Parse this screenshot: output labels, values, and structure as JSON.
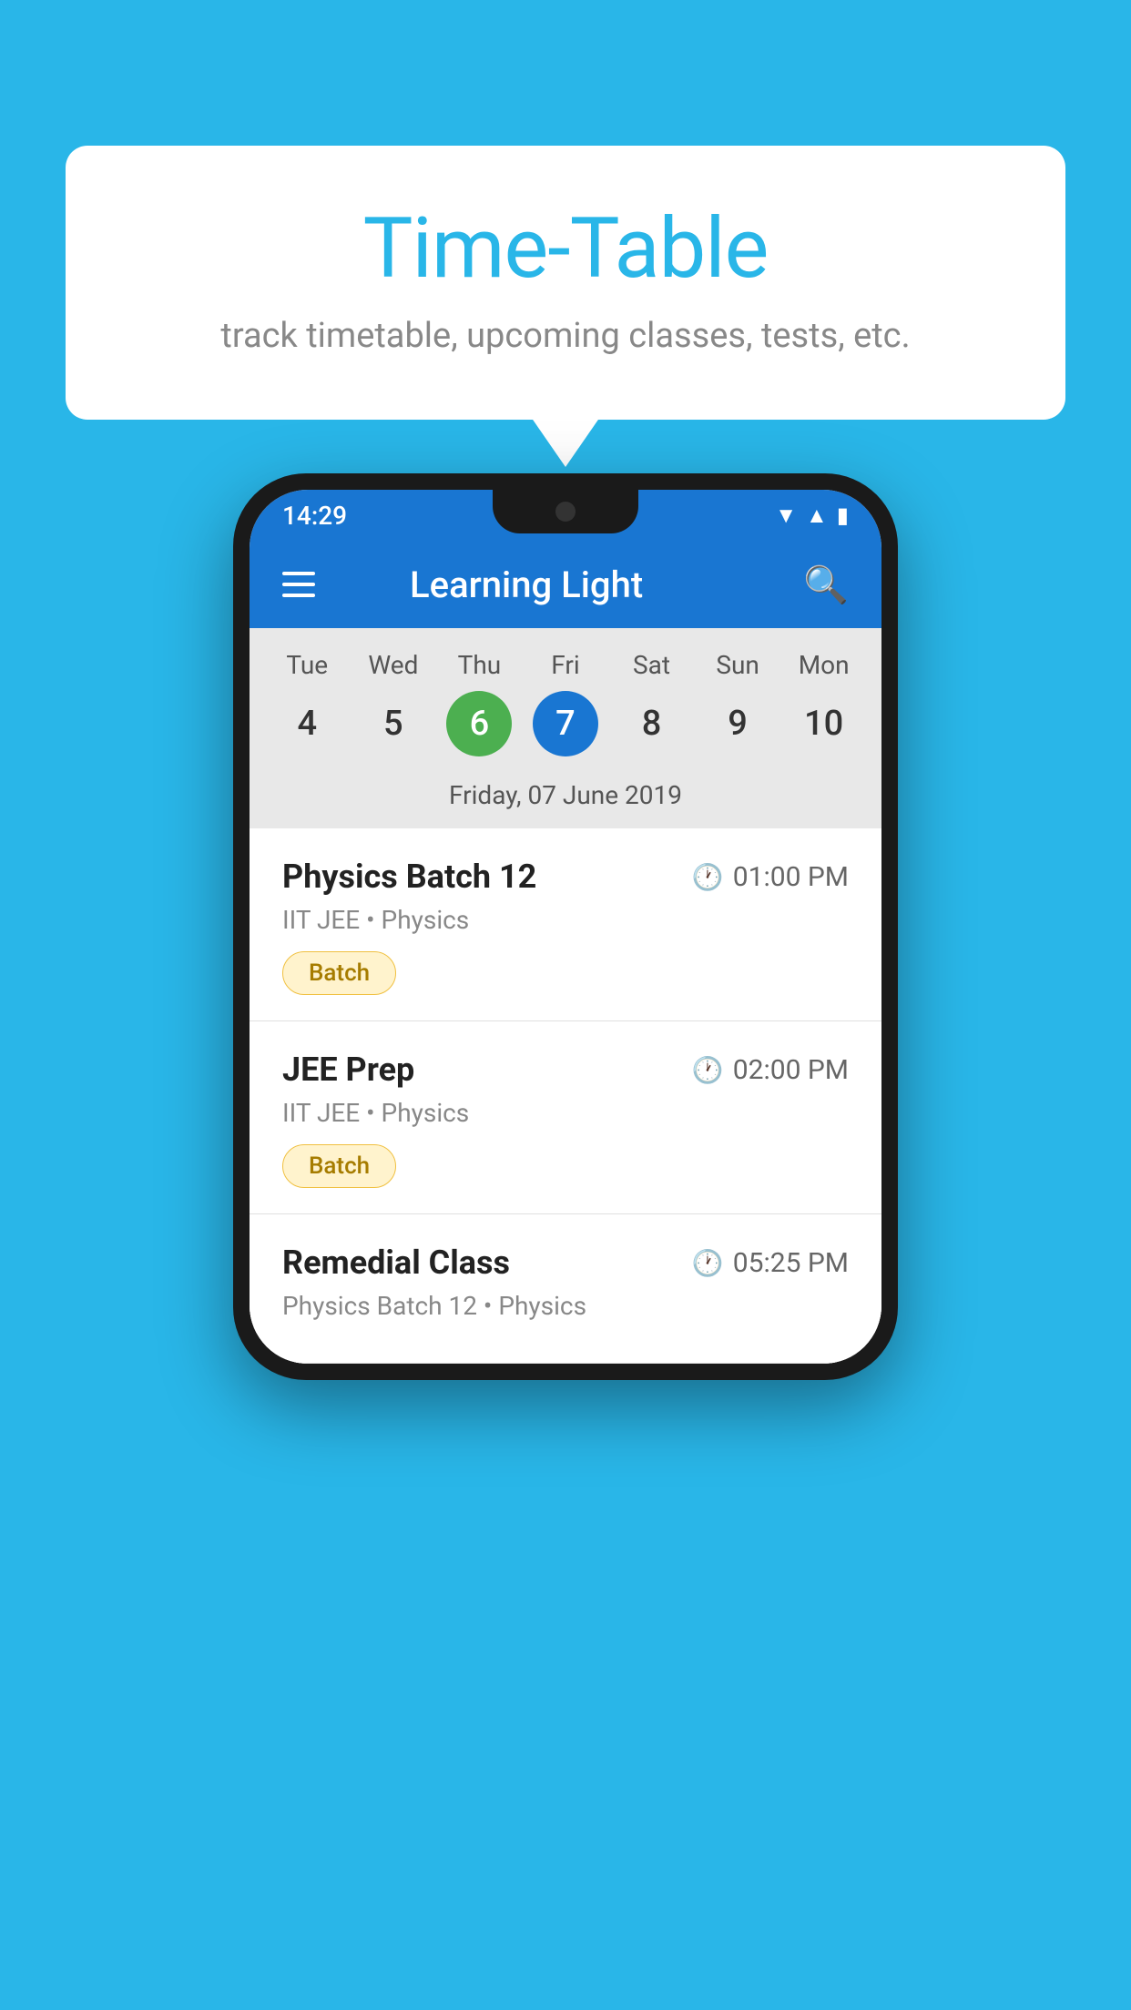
{
  "background_color": "#29B6E8",
  "bubble": {
    "title": "Time-Table",
    "subtitle": "track timetable, upcoming classes, tests, etc."
  },
  "phone": {
    "status_bar": {
      "time": "14:29"
    },
    "app_bar": {
      "title": "Learning Light"
    },
    "calendar": {
      "days": [
        {
          "name": "Tue",
          "number": "4",
          "state": "normal"
        },
        {
          "name": "Wed",
          "number": "5",
          "state": "normal"
        },
        {
          "name": "Thu",
          "number": "6",
          "state": "today"
        },
        {
          "name": "Fri",
          "number": "7",
          "state": "selected"
        },
        {
          "name": "Sat",
          "number": "8",
          "state": "normal"
        },
        {
          "name": "Sun",
          "number": "9",
          "state": "normal"
        },
        {
          "name": "Mon",
          "number": "10",
          "state": "normal"
        }
      ],
      "selected_date_label": "Friday, 07 June 2019"
    },
    "schedule": [
      {
        "title": "Physics Batch 12",
        "time": "01:00 PM",
        "subtitle": "IIT JEE • Physics",
        "badge": "Batch"
      },
      {
        "title": "JEE Prep",
        "time": "02:00 PM",
        "subtitle": "IIT JEE • Physics",
        "badge": "Batch"
      },
      {
        "title": "Remedial Class",
        "time": "05:25 PM",
        "subtitle": "Physics Batch 12 • Physics",
        "badge": null
      }
    ]
  }
}
